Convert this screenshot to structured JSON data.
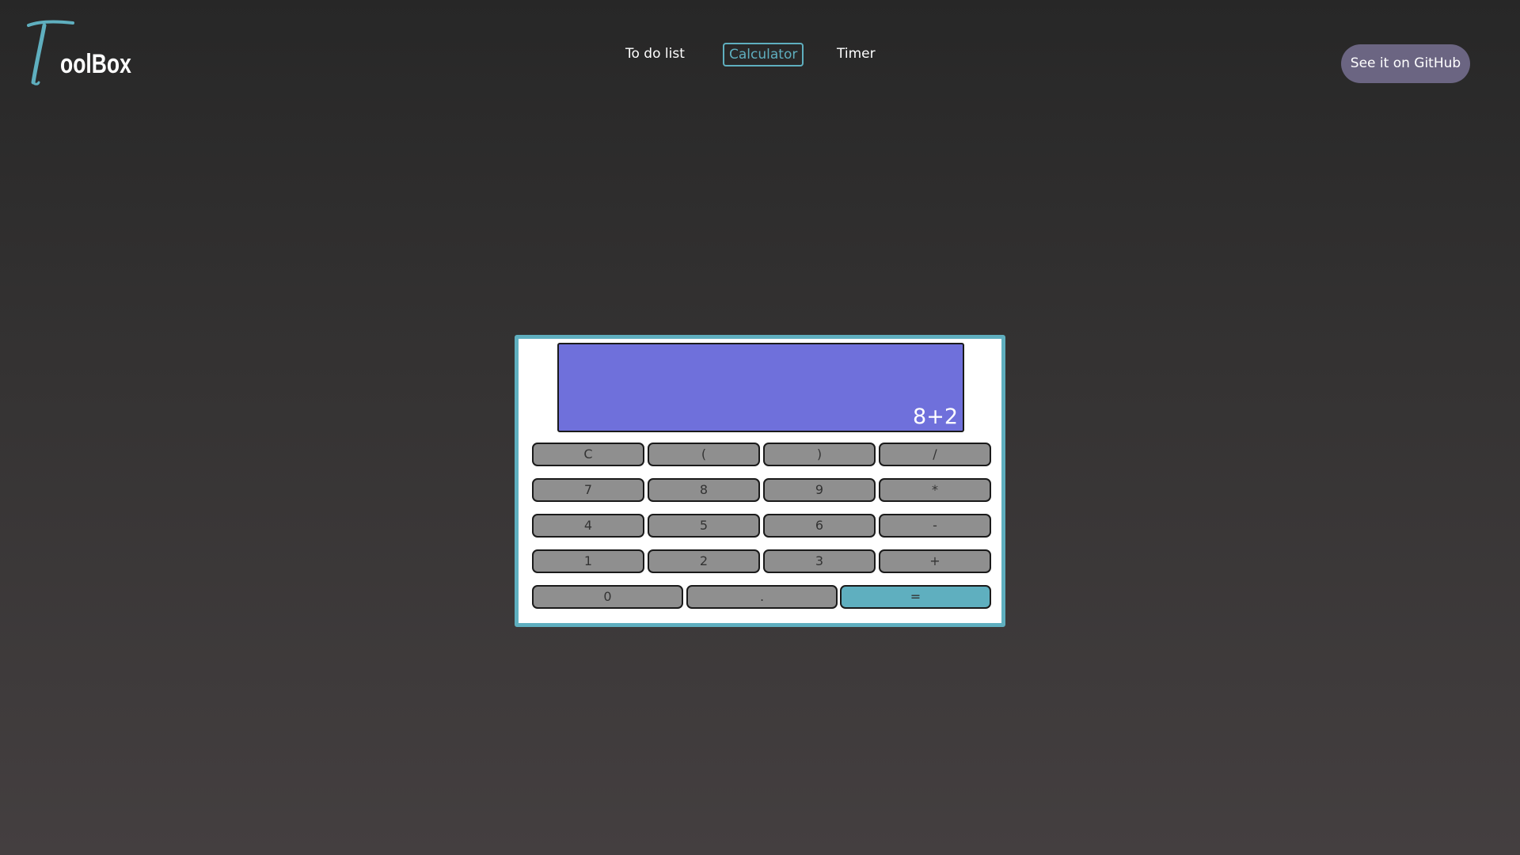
{
  "logo": {
    "first_letter": "T",
    "rest": "oolBox",
    "accent_color": "#5fafbf"
  },
  "nav": {
    "items": [
      {
        "label": "To do list",
        "active": false
      },
      {
        "label": "Calculator",
        "active": true
      },
      {
        "label": "Timer",
        "active": false
      }
    ]
  },
  "github_button": {
    "label": "See it on GitHub"
  },
  "calculator": {
    "display_value": "8+2",
    "display_color": "#6f70db",
    "equals_color": "#5fafbf",
    "rows": [
      [
        "C",
        "(",
        ")",
        "/"
      ],
      [
        "7",
        "8",
        "9",
        "*"
      ],
      [
        "4",
        "5",
        "6",
        "-"
      ],
      [
        "1",
        "2",
        "3",
        "+"
      ],
      [
        "0",
        ".",
        "="
      ]
    ]
  }
}
